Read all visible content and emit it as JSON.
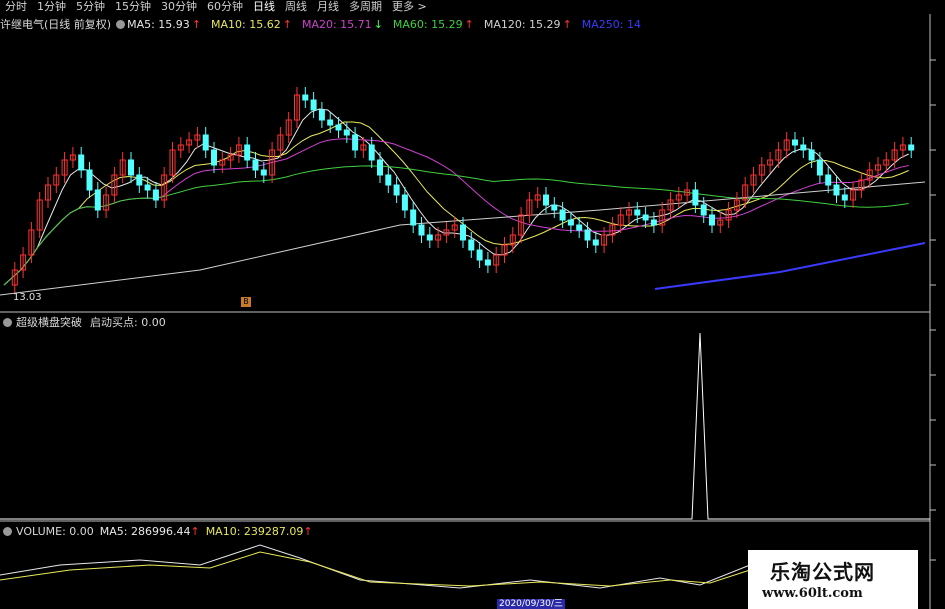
{
  "tabs": [
    {
      "label": "分时"
    },
    {
      "label": "1分钟"
    },
    {
      "label": "5分钟"
    },
    {
      "label": "15分钟"
    },
    {
      "label": "30分钟"
    },
    {
      "label": "60分钟"
    },
    {
      "label": "日线"
    },
    {
      "label": "周线"
    },
    {
      "label": "月线"
    },
    {
      "label": "多周期"
    },
    {
      "label": "更多"
    }
  ],
  "more_arrow": ">",
  "main_panel": {
    "stock_title": "许继电气(日线 前复权)",
    "ma": [
      {
        "label": "MA5: 15.93",
        "arrow": "↑",
        "color": "#e8e8e8"
      },
      {
        "label": "MA10: 15.62",
        "arrow": "↑",
        "color": "#e8e85a"
      },
      {
        "label": "MA20: 15.71",
        "arrow": "↓",
        "color": "#d040d0"
      },
      {
        "label": "MA60: 15.29",
        "arrow": "↑",
        "color": "#40d040"
      },
      {
        "label": "MA120: 15.29",
        "arrow": "↑",
        "color": "#d0d0d0"
      },
      {
        "label": "MA250: 14",
        "arrow": "",
        "color": "#3a3aff"
      }
    ],
    "low_price_label": "13.03",
    "marker_glyph": "B"
  },
  "indicator_panel": {
    "name": "超级横盘突破",
    "param": "启动买点: 0.00"
  },
  "volume_panel": {
    "label": "VOLUME: 0.00",
    "ma5": "MA5: 286996.44",
    "ma10": "MA10: 239287.09",
    "date_label": "2020/09/30/三"
  },
  "watermark": {
    "title": "乐淘公式网",
    "url": "www.60lt.com"
  },
  "colors": {
    "up": "#ff3232",
    "down": "#54ffff",
    "ma5": "#e8e8e8",
    "ma10": "#e8e85a",
    "ma20": "#d040d0",
    "ma60": "#40d040",
    "ma250": "#3a3aff",
    "grid": "#ffffff"
  }
}
